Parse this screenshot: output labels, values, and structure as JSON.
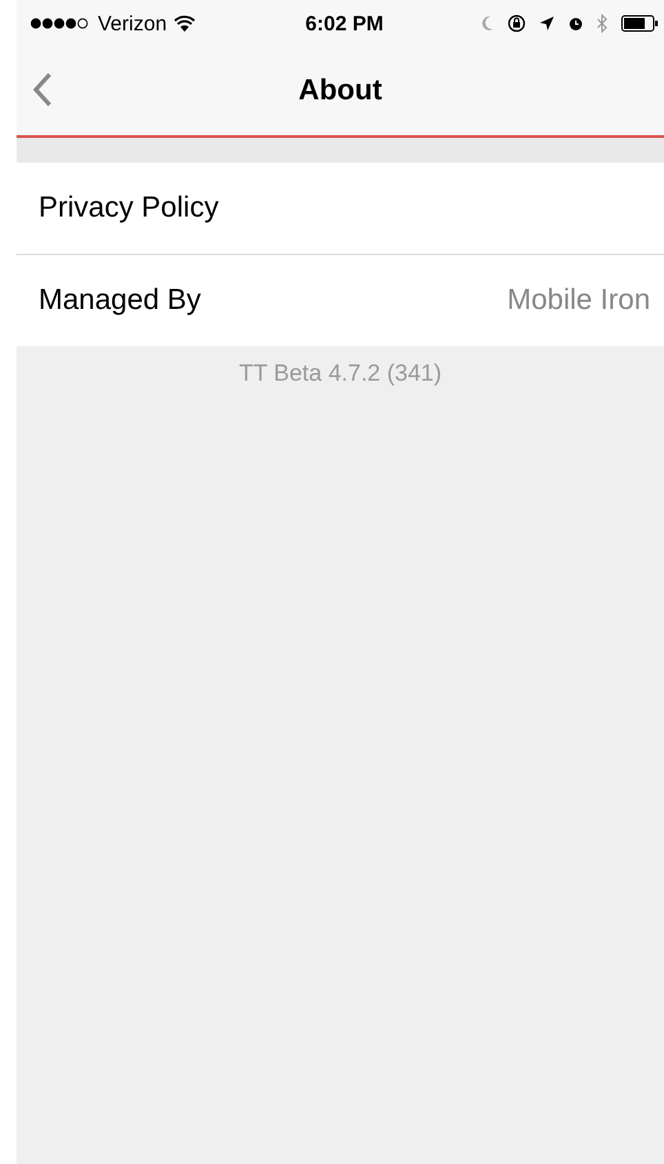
{
  "status_bar": {
    "carrier": "Verizon",
    "time": "6:02 PM"
  },
  "nav": {
    "title": "About"
  },
  "rows": [
    {
      "label": "Privacy Policy"
    },
    {
      "label": "Managed By",
      "value": "Mobile Iron"
    }
  ],
  "version": "TT Beta 4.7.2 (341)"
}
